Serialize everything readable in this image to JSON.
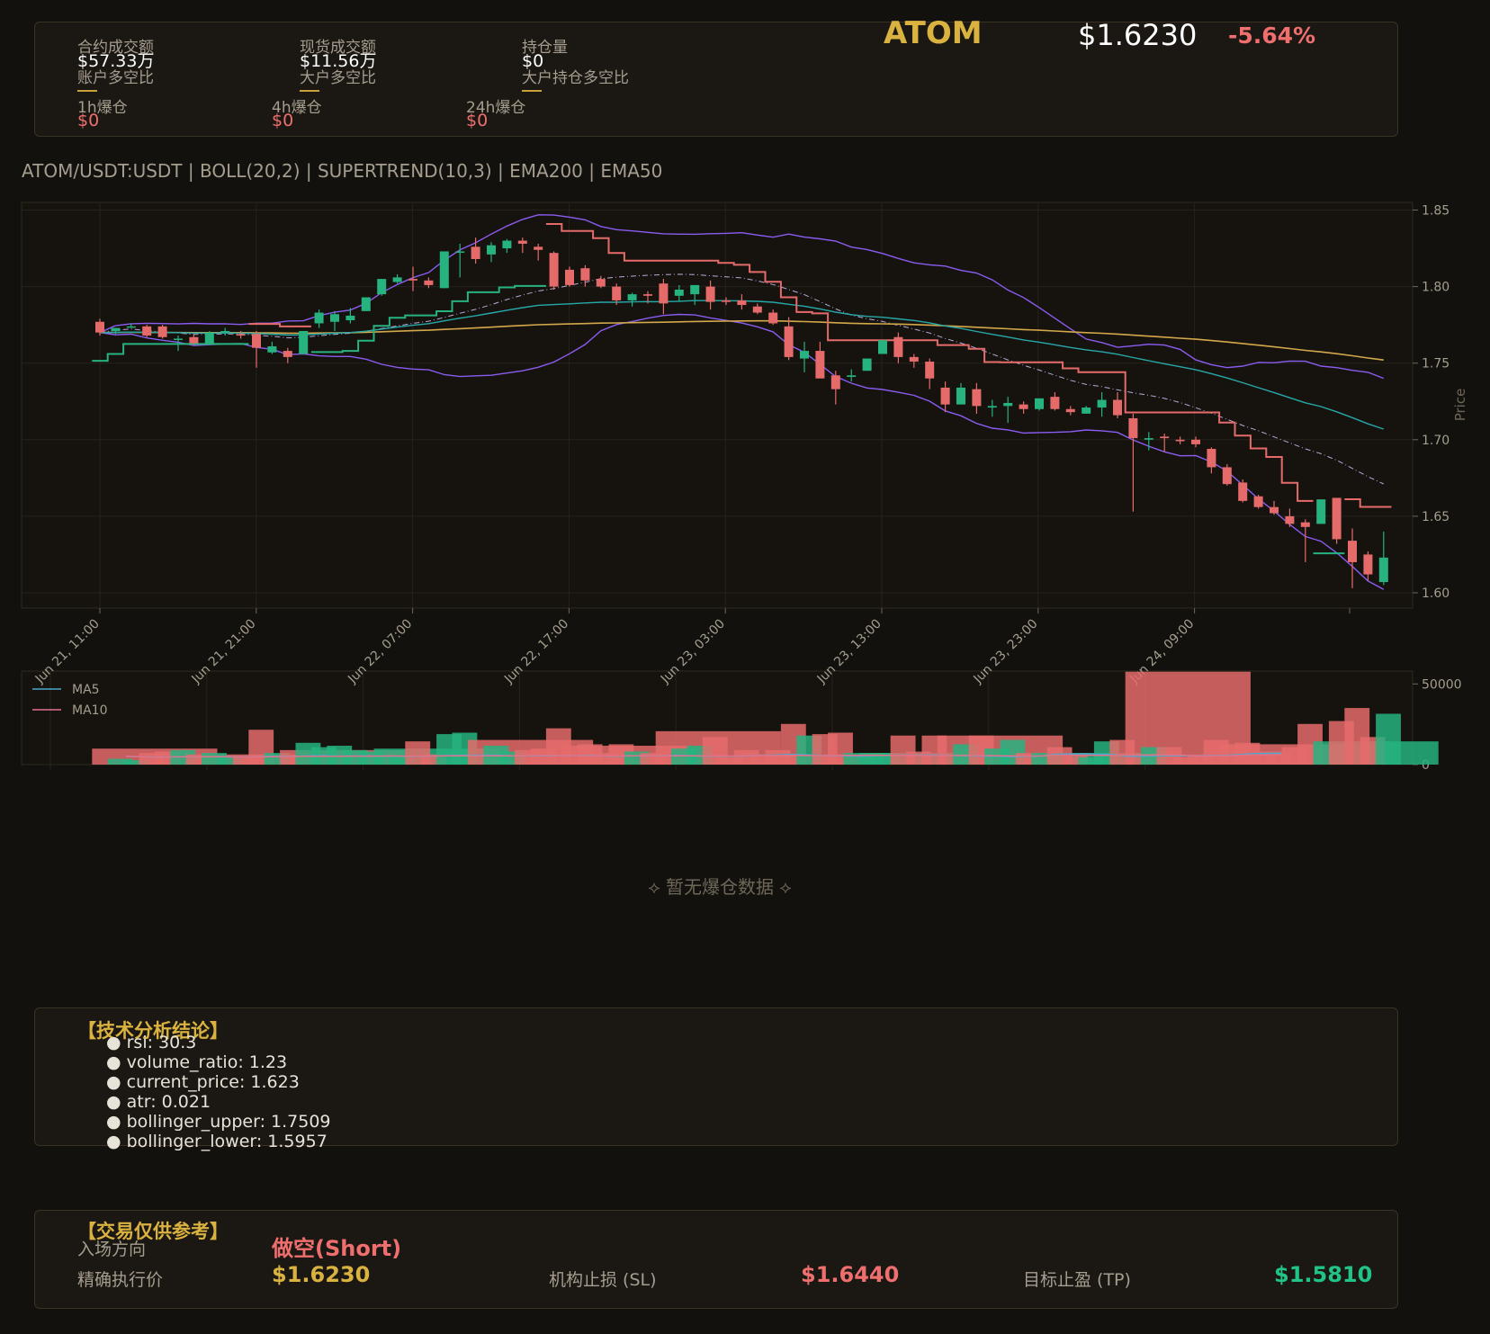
{
  "header": {
    "symbol": "ATOM",
    "price": "$1.6230",
    "change": "-5.64%",
    "stats": [
      {
        "label": "合约成交额",
        "value": "$57.33万",
        "sub": "账户多空比"
      },
      {
        "label": "现货成交额",
        "value": "$11.56万",
        "sub": "大户多空比"
      },
      {
        "label": "持仓量",
        "value": "$0",
        "sub": "大户持仓多空比"
      }
    ],
    "liquidations": [
      {
        "label": "1h爆仓",
        "value": "$0"
      },
      {
        "label": "4h爆仓",
        "value": "$0"
      },
      {
        "label": "24h爆仓",
        "value": "$0"
      }
    ]
  },
  "chart_title": "ATOM/USDT:USDT | BOLL(20,2) | SUPERTREND(10,3) | EMA200 | EMA50",
  "chart_data": {
    "type": "candlestick",
    "ylabel": "Price",
    "ylim": [
      1.59,
      1.855
    ],
    "yticks": [
      "1.85",
      "1.80",
      "1.75",
      "1.70",
      "1.65",
      "1.60"
    ],
    "xticks": [
      "Jun 21, 11:00",
      "Jun 21, 21:00",
      "Jun 22, 07:00",
      "Jun 22, 17:00",
      "Jun 23, 03:00",
      "Jun 23, 13:00",
      "Jun 23, 23:00",
      "Jun 24, 09:00"
    ],
    "candles": [
      [
        1.777,
        1.779,
        1.768,
        1.77
      ],
      [
        1.771,
        1.773,
        1.769,
        1.773
      ],
      [
        1.774,
        1.776,
        1.773,
        1.774
      ],
      [
        1.774,
        1.775,
        1.767,
        1.768
      ],
      [
        1.774,
        1.775,
        1.766,
        1.767
      ],
      [
        1.766,
        1.768,
        1.758,
        1.766
      ],
      [
        1.767,
        1.769,
        1.762,
        1.763
      ],
      [
        1.763,
        1.771,
        1.763,
        1.77
      ],
      [
        1.77,
        1.773,
        1.768,
        1.771
      ],
      [
        1.769,
        1.771,
        1.766,
        1.768
      ],
      [
        1.769,
        1.771,
        1.747,
        1.76
      ],
      [
        1.757,
        1.764,
        1.756,
        1.761
      ],
      [
        1.758,
        1.76,
        1.75,
        1.754
      ],
      [
        1.756,
        1.771,
        1.756,
        1.771
      ],
      [
        1.776,
        1.785,
        1.773,
        1.783
      ],
      [
        1.777,
        1.784,
        1.771,
        1.782
      ],
      [
        1.778,
        1.786,
        1.776,
        1.781
      ],
      [
        1.784,
        1.793,
        1.784,
        1.793
      ],
      [
        1.795,
        1.805,
        1.794,
        1.805
      ],
      [
        1.803,
        1.808,
        1.802,
        1.806
      ],
      [
        1.805,
        1.813,
        1.797,
        1.804
      ],
      [
        1.804,
        1.806,
        1.799,
        1.801
      ],
      [
        1.799,
        1.82,
        1.799,
        1.823
      ],
      [
        1.823,
        1.828,
        1.806,
        1.823
      ],
      [
        1.826,
        1.832,
        1.815,
        1.818
      ],
      [
        1.821,
        1.829,
        1.816,
        1.827
      ],
      [
        1.825,
        1.831,
        1.822,
        1.83
      ],
      [
        1.83,
        1.832,
        1.822,
        1.828
      ],
      [
        1.826,
        1.828,
        1.817,
        1.824
      ],
      [
        1.822,
        1.823,
        1.798,
        1.8
      ],
      [
        1.811,
        1.813,
        1.8,
        1.801
      ],
      [
        1.812,
        1.814,
        1.8,
        1.804
      ],
      [
        1.805,
        1.807,
        1.799,
        1.8
      ],
      [
        1.8,
        1.802,
        1.788,
        1.791
      ],
      [
        1.791,
        1.796,
        1.787,
        1.795
      ],
      [
        1.795,
        1.797,
        1.789,
        1.794
      ],
      [
        1.802,
        1.805,
        1.782,
        1.789
      ],
      [
        1.794,
        1.801,
        1.79,
        1.798
      ],
      [
        1.795,
        1.801,
        1.788,
        1.801
      ],
      [
        1.8,
        1.804,
        1.785,
        1.79
      ],
      [
        1.791,
        1.793,
        1.788,
        1.79
      ],
      [
        1.791,
        1.795,
        1.785,
        1.788
      ],
      [
        1.787,
        1.789,
        1.782,
        1.783
      ],
      [
        1.783,
        1.785,
        1.775,
        1.776
      ],
      [
        1.774,
        1.78,
        1.752,
        1.754
      ],
      [
        1.753,
        1.764,
        1.744,
        1.758
      ],
      [
        1.758,
        1.764,
        1.743,
        1.74
      ],
      [
        1.742,
        1.745,
        1.723,
        1.733
      ],
      [
        1.741,
        1.746,
        1.738,
        1.742
      ],
      [
        1.745,
        1.753,
        1.745,
        1.753
      ],
      [
        1.756,
        1.764,
        1.756,
        1.765
      ],
      [
        1.767,
        1.77,
        1.75,
        1.754
      ],
      [
        1.754,
        1.756,
        1.747,
        1.751
      ],
      [
        1.751,
        1.753,
        1.733,
        1.74
      ],
      [
        1.734,
        1.738,
        1.718,
        1.723
      ],
      [
        1.723,
        1.737,
        1.723,
        1.734
      ],
      [
        1.733,
        1.737,
        1.717,
        1.722
      ],
      [
        1.721,
        1.726,
        1.715,
        1.722
      ],
      [
        1.722,
        1.728,
        1.711,
        1.724
      ],
      [
        1.723,
        1.725,
        1.717,
        1.72
      ],
      [
        1.72,
        1.727,
        1.719,
        1.727
      ],
      [
        1.728,
        1.731,
        1.719,
        1.72
      ],
      [
        1.72,
        1.722,
        1.716,
        1.718
      ],
      [
        1.717,
        1.722,
        1.717,
        1.721
      ],
      [
        1.721,
        1.731,
        1.715,
        1.726
      ],
      [
        1.726,
        1.731,
        1.714,
        1.716
      ],
      [
        1.714,
        1.717,
        1.653,
        1.701
      ],
      [
        1.7,
        1.705,
        1.693,
        1.701
      ],
      [
        1.702,
        1.704,
        1.692,
        1.701
      ],
      [
        1.7,
        1.702,
        1.697,
        1.699
      ],
      [
        1.7,
        1.702,
        1.695,
        1.697
      ],
      [
        1.694,
        1.695,
        1.678,
        1.682
      ],
      [
        1.682,
        1.684,
        1.67,
        1.671
      ],
      [
        1.672,
        1.674,
        1.659,
        1.66
      ],
      [
        1.663,
        1.664,
        1.655,
        1.656
      ],
      [
        1.656,
        1.66,
        1.651,
        1.652
      ],
      [
        1.65,
        1.655,
        1.643,
        1.645
      ],
      [
        1.646,
        1.648,
        1.62,
        1.643
      ],
      [
        1.645,
        1.661,
        1.645,
        1.661
      ],
      [
        1.662,
        1.662,
        1.632,
        1.635
      ],
      [
        1.634,
        1.642,
        1.603,
        1.62
      ],
      [
        1.625,
        1.627,
        1.608,
        1.612
      ],
      [
        1.607,
        1.64,
        1.605,
        1.623
      ]
    ]
  },
  "volume_legend": [
    "MA5",
    "MA10"
  ],
  "volume_yticks": [
    "50000",
    "0"
  ],
  "liq_empty": "⟡ 暂无爆仓数据 ⟡",
  "analysis": {
    "title": "【技术分析结论】",
    "items": [
      "rsi: 30.3",
      "volume_ratio: 1.23",
      "current_price: 1.623",
      "atr: 0.021",
      "bollinger_upper: 1.7509",
      "bollinger_lower: 1.5957"
    ]
  },
  "trade": {
    "title": "【交易仅供参考】",
    "direction_label": "入场方向",
    "direction_value": "做空(Short)",
    "entry_label": "精确执行价",
    "entry_value": "$1.6230",
    "sl_label": "机构止损 (SL)",
    "sl_value": "$1.6440",
    "tp_label": "目标止盈 (TP)",
    "tp_value": "$1.5810"
  },
  "colors": {
    "up": "#26b37f",
    "down": "#e56b6b",
    "bb": "#8a5cf0",
    "ema200": "#d3a84a",
    "ema50": "#27a8a8",
    "accent": "#d9b240"
  }
}
